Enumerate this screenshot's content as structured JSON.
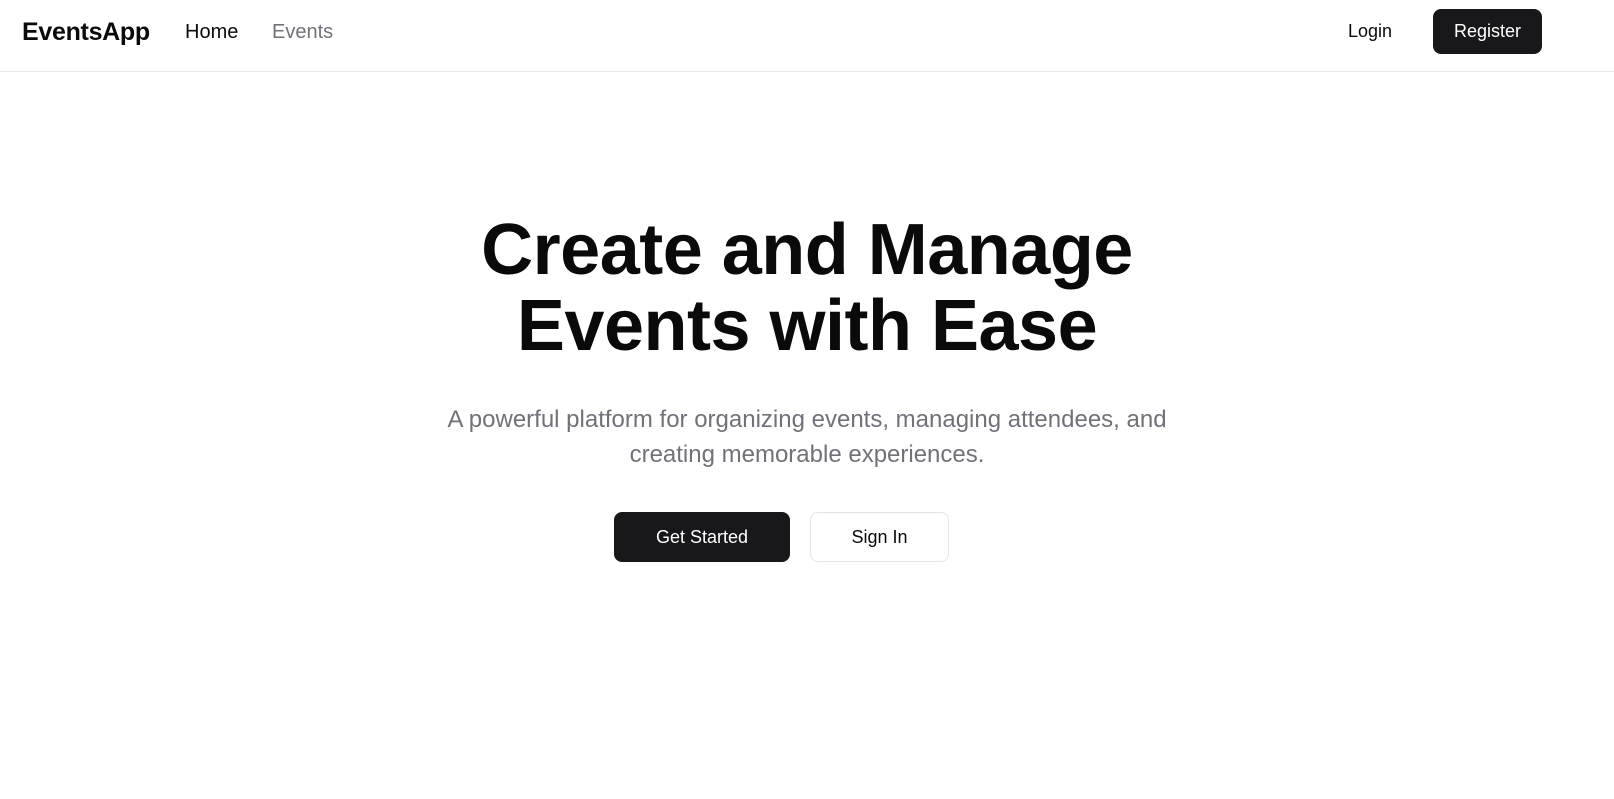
{
  "header": {
    "brand": "EventsApp",
    "nav": {
      "home": "Home",
      "events": "Events"
    },
    "login_label": "Login",
    "register_label": "Register"
  },
  "hero": {
    "title_line1": "Create and Manage",
    "title_line2": "Events with Ease",
    "subtitle_line1": "A powerful platform for organizing events, managing attendees, and",
    "subtitle_line2": "creating memorable experiences.",
    "primary_cta": "Get Started",
    "secondary_cta": "Sign In"
  },
  "colors": {
    "primary": "#18181b",
    "text": "#0a0a0a",
    "muted": "#71717a",
    "border": "#e5e7eb",
    "background": "#ffffff"
  }
}
